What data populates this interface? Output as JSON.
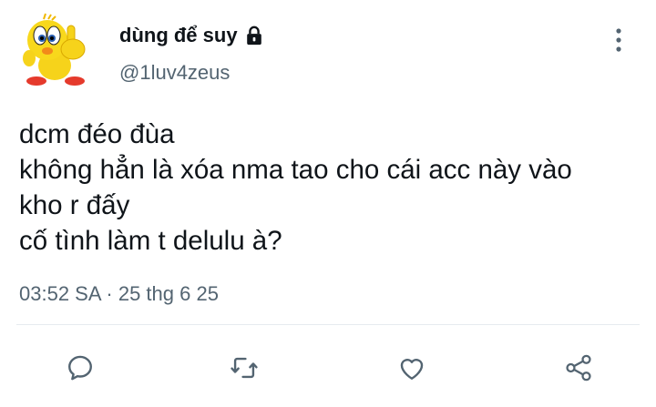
{
  "author": {
    "display_name": "dùng để suy",
    "handle": "@1luv4zeus",
    "protected": true
  },
  "tweet": {
    "lines": [
      "dcm đéo đùa",
      "không hẳn là xóa nma tao cho cái acc này vào",
      "kho r đấy",
      "cố tình làm t delulu à?"
    ],
    "timestamp": "03:52 SA · 25 thg 6 25"
  },
  "icons": {
    "lock": "lock-icon",
    "more": "more-vertical-icon",
    "reply": "reply-icon",
    "retweet": "retweet-icon",
    "like": "heart-icon",
    "share": "share-icon"
  },
  "colors": {
    "text": "#0f1419",
    "secondary": "#536471",
    "action": "#536471",
    "divider": "#e6ebef"
  }
}
